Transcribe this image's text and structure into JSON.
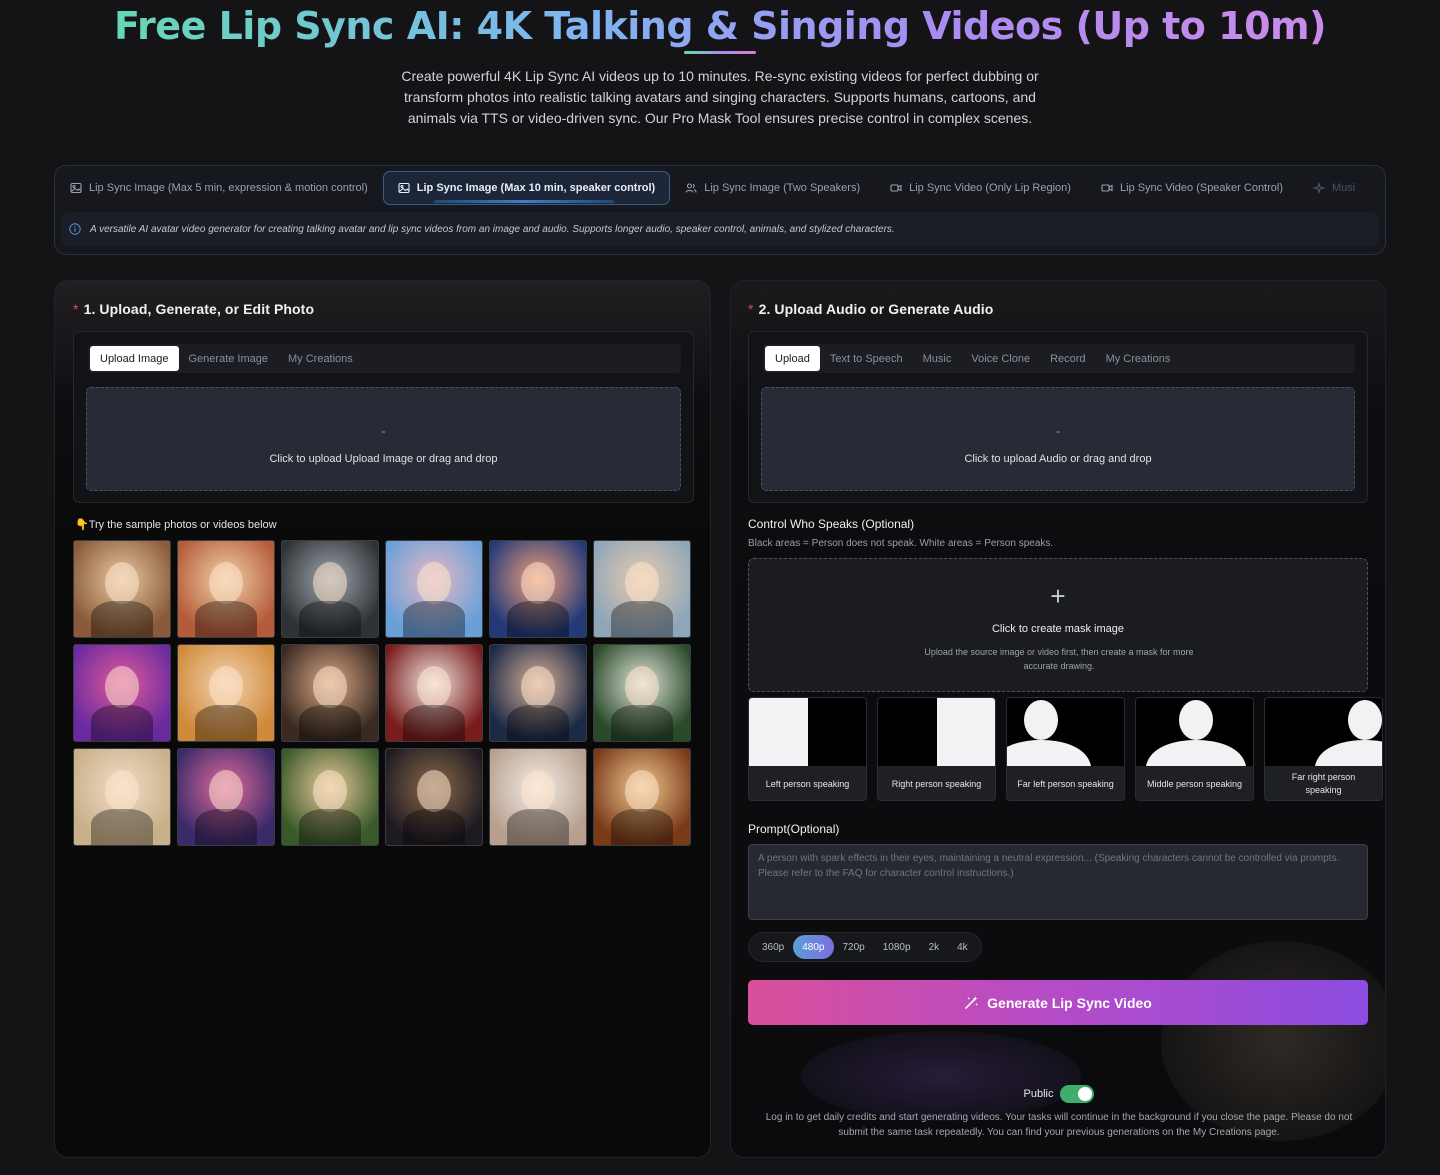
{
  "hero": {
    "title": "Free Lip Sync AI: 4K Talking & Singing Videos (Up to 10m)",
    "description": "Create powerful 4K Lip Sync AI videos up to 10 minutes. Re-sync existing videos for perfect dubbing or transform photos into realistic talking avatars and singing characters. Supports humans, cartoons, and animals via TTS or video-driven sync. Our Pro Mask Tool ensures precise control in complex scenes."
  },
  "modes": {
    "tabs": [
      {
        "label": "Lip Sync Image (Max 5 min, expression & motion control)",
        "icon": "image-icon"
      },
      {
        "label": "Lip Sync Image (Max 10 min, speaker control)",
        "icon": "image-icon",
        "active": true
      },
      {
        "label": "Lip Sync Image (Two Speakers)",
        "icon": "users-icon"
      },
      {
        "label": "Lip Sync Video (Only Lip Region)",
        "icon": "video-icon"
      },
      {
        "label": "Lip Sync Video (Speaker Control)",
        "icon": "video-icon"
      },
      {
        "label": "Musi",
        "icon": "sparkle-icon"
      }
    ],
    "info": "A versatile AI avatar video generator for creating talking avatar and lip sync videos from an image and audio. Supports longer audio, speaker control, animals, and stylized characters."
  },
  "photo_section": {
    "required_mark": "*",
    "title": "1. Upload, Generate, or Edit Photo",
    "tabs": [
      "Upload Image",
      "Generate Image",
      "My Creations"
    ],
    "drop_dash": "-",
    "drop_text": "Click to upload Upload Image or drag and drop",
    "samples_heading": "👇Try the sample photos or videos below",
    "samples": [
      {
        "name": "singing-cat",
        "c1": "#8a5a3a",
        "c2": "#e8c9a0"
      },
      {
        "name": "kitten-couch",
        "c1": "#b55a3a",
        "c2": "#f0d2a8"
      },
      {
        "name": "gorilla-car",
        "c1": "#2e3236",
        "c2": "#9fa6ad"
      },
      {
        "name": "bunny-officer",
        "c1": "#6aa0d8",
        "c2": "#e7b9c4"
      },
      {
        "name": "baby-microphone",
        "c1": "#243a78",
        "c2": "#f0a07a"
      },
      {
        "name": "baby-singing",
        "c1": "#8fa6b8",
        "c2": "#e8cbb0"
      },
      {
        "name": "pop-star-baby",
        "c1": "#6a2aa0",
        "c2": "#e05a9a"
      },
      {
        "name": "baby-headphones",
        "c1": "#d08a3a",
        "c2": "#f2d2b0"
      },
      {
        "name": "smiling-man",
        "c1": "#3a2a22",
        "c2": "#d9a685"
      },
      {
        "name": "santa-claus",
        "c1": "#7a1c1c",
        "c2": "#efe6e0"
      },
      {
        "name": "man-microphone",
        "c1": "#1c2a48",
        "c2": "#d8b095"
      },
      {
        "name": "joker",
        "c1": "#2a4a2a",
        "c2": "#dfe3d8"
      },
      {
        "name": "blonde-woman",
        "c1": "#c8b088",
        "c2": "#f2dcc8"
      },
      {
        "name": "harley-quinn",
        "c1": "#3a2a6a",
        "c2": "#e06a9a"
      },
      {
        "name": "snow-white",
        "c1": "#3a5a2a",
        "c2": "#e8c898"
      },
      {
        "name": "dark-sorceress",
        "c1": "#1e1a22",
        "c2": "#8a6a4a"
      },
      {
        "name": "woman-stage",
        "c1": "#b8a090",
        "c2": "#f4ece6"
      },
      {
        "name": "woman-singing",
        "c1": "#7a3a18",
        "c2": "#f0c890"
      }
    ]
  },
  "audio_section": {
    "required_mark": "*",
    "title": "2. Upload Audio or Generate Audio",
    "tabs": [
      "Upload",
      "Text to Speech",
      "Music",
      "Voice Clone",
      "Record",
      "My Creations"
    ],
    "drop_dash": "-",
    "drop_text": "Click to upload Audio or drag and drop",
    "control_title": "Control Who Speaks (Optional)",
    "control_sub": "Black areas = Person does not speak. White areas = Person speaks.",
    "mask_plus": "+",
    "mask_title": "Click to create mask image",
    "mask_sub": "Upload the source image or video first, then create a mask for more accurate drawing.",
    "presets": [
      {
        "label": "Left person speaking",
        "kind": "left"
      },
      {
        "label": "Right person speaking",
        "kind": "right"
      },
      {
        "label": "Far left person speaking",
        "kind": "farleft"
      },
      {
        "label": "Middle person speaking",
        "kind": "middle"
      },
      {
        "label": "Far right person speaking",
        "kind": "farright"
      }
    ],
    "prompt_title": "Prompt(Optional)",
    "prompt_placeholder": "A person with spark effects in their eyes, maintaining a neutral expression... (Speaking characters cannot be controlled via prompts. Please refer to the FAQ for character control instructions.)",
    "resolutions": [
      "360p",
      "480p",
      "720p",
      "1080p",
      "2k",
      "4k"
    ],
    "selected_resolution": "480p",
    "generate_label": "Generate Lip Sync Video",
    "public_label": "Public",
    "public_on": true,
    "footnote": "Log in to get daily credits and start generating videos. Your tasks will continue in the background if you close the page. Please do not submit the same task repeatedly. You can find your previous generations on the My Creations page."
  }
}
